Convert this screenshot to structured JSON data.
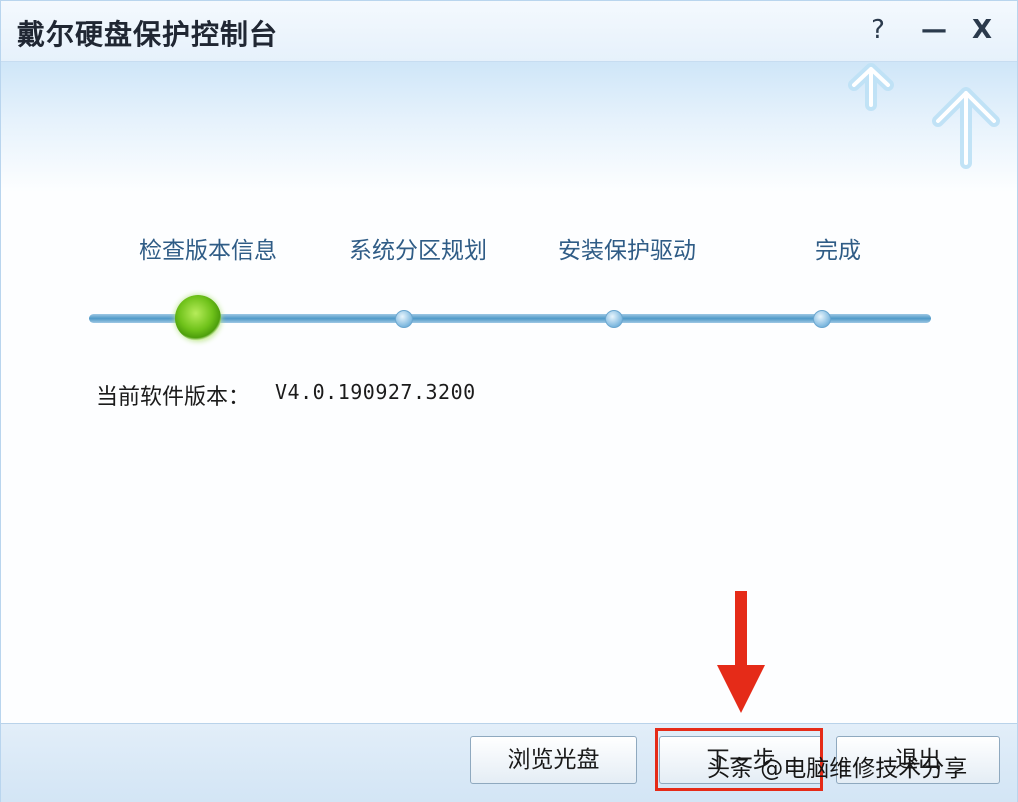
{
  "window": {
    "title": "戴尔硬盘保护控制台",
    "controls": {
      "help": "?",
      "minimize": "—",
      "close": "X"
    }
  },
  "steps": [
    {
      "label": "检查版本信息",
      "state": "current"
    },
    {
      "label": "系统分区规划",
      "state": "pending"
    },
    {
      "label": "安装保护驱动",
      "state": "pending"
    },
    {
      "label": "完成",
      "state": "pending"
    }
  ],
  "info": {
    "version_label": "当前软件版本：",
    "version_value": "V4.0.190927.3200"
  },
  "buttons": {
    "browse": "浏览光盘",
    "next": "下一步",
    "exit": "退出"
  },
  "watermark": "头条 @电脑维修技术分享",
  "colors": {
    "accent_green": "#6fc21a",
    "track_blue": "#4f99c8",
    "highlight_red": "#e52b18"
  }
}
